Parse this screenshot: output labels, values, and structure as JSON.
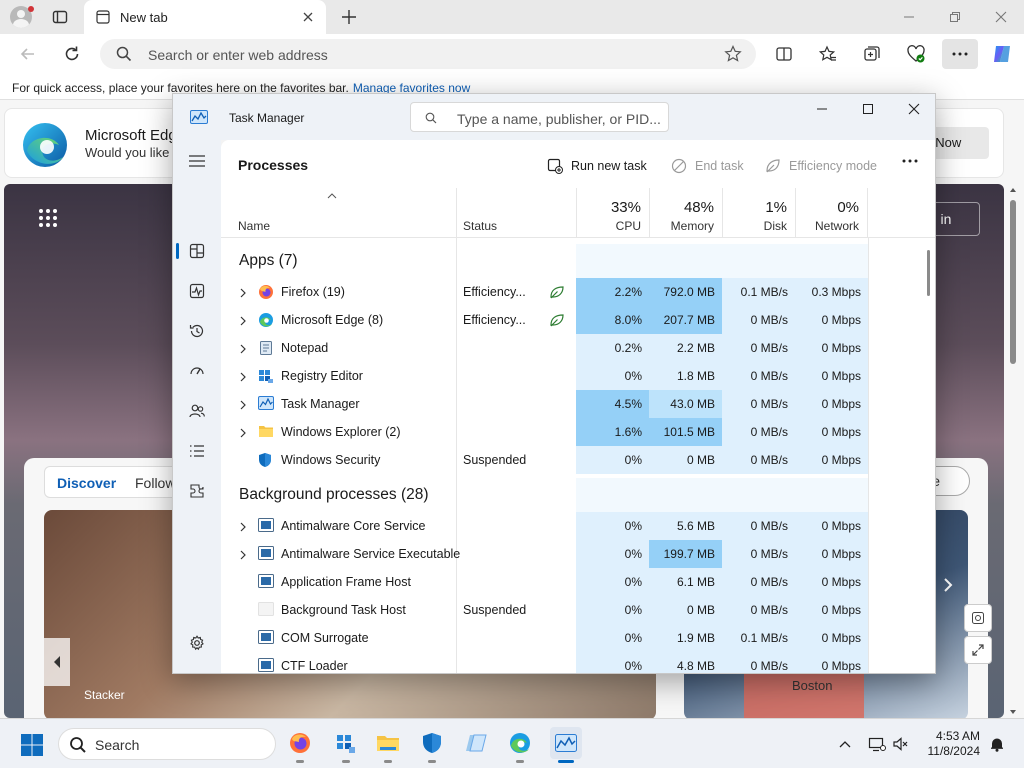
{
  "browser": {
    "tab_title": "New tab",
    "address_placeholder": "Search or enter web address",
    "favorites_hint": "For quick access, place your favorites here on the favorites bar.",
    "favorites_link": "Manage favorites now"
  },
  "promo": {
    "title": "Microsoft Edg",
    "subtitle": "Would you like t",
    "button": "ot Now"
  },
  "feed": {
    "sign_in": "gn in",
    "discover": "Discover",
    "following": "Follow",
    "personalize": "lize",
    "card_source": "Stacker",
    "card_city": "Boston"
  },
  "taskmanager": {
    "title": "Task Manager",
    "search_placeholder": "Type a name, publisher, or PID...",
    "page_title": "Processes",
    "actions": {
      "run_new_task": "Run new task",
      "end_task": "End task",
      "efficiency_mode": "Efficiency mode"
    },
    "columns": {
      "name": "Name",
      "status": "Status",
      "cpu": {
        "pct": "33%",
        "label": "CPU"
      },
      "memory": {
        "pct": "48%",
        "label": "Memory"
      },
      "disk": {
        "pct": "1%",
        "label": "Disk"
      },
      "network": {
        "pct": "0%",
        "label": "Network"
      }
    },
    "sections": {
      "apps": "Apps (7)",
      "background": "Background processes (28)"
    },
    "apps": [
      {
        "name": "Firefox (19)",
        "status": "Efficiency...",
        "cpu": "2.2%",
        "mem": "792.0 MB",
        "disk": "0.1 MB/s",
        "net": "0.3 Mbps",
        "icon": "firefox-icon"
      },
      {
        "name": "Microsoft Edge (8)",
        "status": "Efficiency...",
        "cpu": "8.0%",
        "mem": "207.7 MB",
        "disk": "0 MB/s",
        "net": "0 Mbps",
        "icon": "edge-icon"
      },
      {
        "name": "Notepad",
        "status": "",
        "cpu": "0.2%",
        "mem": "2.2 MB",
        "disk": "0 MB/s",
        "net": "0 Mbps",
        "icon": "notepad-icon"
      },
      {
        "name": "Registry Editor",
        "status": "",
        "cpu": "0%",
        "mem": "1.8 MB",
        "disk": "0 MB/s",
        "net": "0 Mbps",
        "icon": "registry-editor-icon"
      },
      {
        "name": "Task Manager",
        "status": "",
        "cpu": "4.5%",
        "mem": "43.0 MB",
        "disk": "0 MB/s",
        "net": "0 Mbps",
        "icon": "task-manager-icon"
      },
      {
        "name": "Windows Explorer (2)",
        "status": "",
        "cpu": "1.6%",
        "mem": "101.5 MB",
        "disk": "0 MB/s",
        "net": "0 Mbps",
        "icon": "folder-icon"
      },
      {
        "name": "Windows Security",
        "status": "Suspended",
        "cpu": "0%",
        "mem": "0 MB",
        "disk": "0 MB/s",
        "net": "0 Mbps",
        "icon": "shield-icon"
      }
    ],
    "background": [
      {
        "name": "Antimalware Core Service",
        "status": "",
        "cpu": "0%",
        "mem": "5.6 MB",
        "disk": "0 MB/s",
        "net": "0 Mbps"
      },
      {
        "name": "Antimalware Service Executable",
        "status": "",
        "cpu": "0%",
        "mem": "199.7 MB",
        "disk": "0 MB/s",
        "net": "0 Mbps"
      },
      {
        "name": "Application Frame Host",
        "status": "",
        "cpu": "0%",
        "mem": "6.1 MB",
        "disk": "0 MB/s",
        "net": "0 Mbps"
      },
      {
        "name": "Background Task Host",
        "status": "Suspended",
        "cpu": "0%",
        "mem": "0 MB",
        "disk": "0 MB/s",
        "net": "0 Mbps"
      },
      {
        "name": "COM Surrogate",
        "status": "",
        "cpu": "0%",
        "mem": "1.9 MB",
        "disk": "0.1 MB/s",
        "net": "0 Mbps"
      },
      {
        "name": "CTF Loader",
        "status": "",
        "cpu": "0%",
        "mem": "4.8 MB",
        "disk": "0 MB/s",
        "net": "0 Mbps"
      }
    ]
  },
  "taskbar": {
    "search": "Search",
    "time": "4:53 AM",
    "date": "11/8/2024"
  },
  "colors": {
    "heat_light": "#dff0fd",
    "heat_mid": "#bde3fb",
    "heat_strong": "#95d0f7",
    "accent": "#0067c0"
  }
}
